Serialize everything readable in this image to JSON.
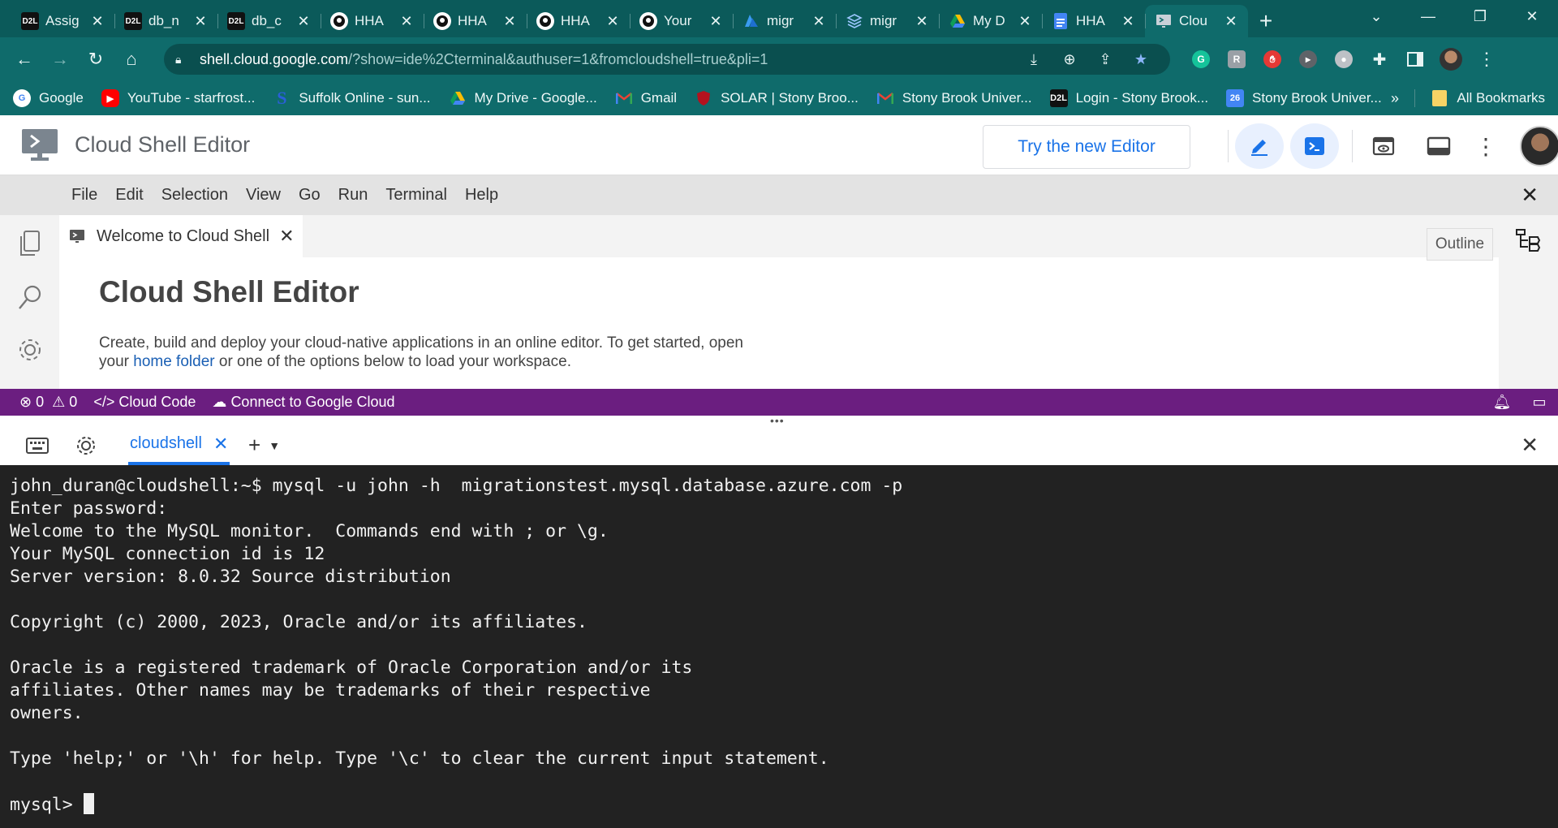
{
  "browser": {
    "tabs": [
      {
        "title": "Assig",
        "icon": "d2l-icon",
        "active": false
      },
      {
        "title": "db_n",
        "icon": "d2l-icon",
        "active": false
      },
      {
        "title": "db_c",
        "icon": "d2l-icon",
        "active": false
      },
      {
        "title": "HHA",
        "icon": "github-icon",
        "active": false
      },
      {
        "title": "HHA",
        "icon": "github-icon",
        "active": false
      },
      {
        "title": "HHA",
        "icon": "github-icon",
        "active": false
      },
      {
        "title": "Your",
        "icon": "github-icon",
        "active": false
      },
      {
        "title": "migr",
        "icon": "azure-icon",
        "active": false
      },
      {
        "title": "migr",
        "icon": "layers-icon",
        "active": false
      },
      {
        "title": "My D",
        "icon": "google-drive-icon",
        "active": false
      },
      {
        "title": "HHA",
        "icon": "google-docs-icon",
        "active": false
      },
      {
        "title": "Clou",
        "icon": "cloud-shell-icon",
        "active": true
      }
    ],
    "url_host": "shell.cloud.google.com",
    "url_rest": "/?show=ide%2Cterminal&authuser=1&fromcloudshell=true&pli=1",
    "bookmarks": [
      {
        "label": "Google",
        "icon": "google-icon"
      },
      {
        "label": "YouTube - starfrost...",
        "icon": "youtube-icon"
      },
      {
        "label": "Suffolk Online - sun...",
        "icon": "suffolk-icon"
      },
      {
        "label": "My Drive - Google...",
        "icon": "google-drive-icon"
      },
      {
        "label": "Gmail",
        "icon": "gmail-icon"
      },
      {
        "label": "SOLAR | Stony Broo...",
        "icon": "shield-icon"
      },
      {
        "label": "Stony Brook Univer...",
        "icon": "gmail-icon"
      },
      {
        "label": "Login - Stony Brook...",
        "icon": "d2l-icon"
      },
      {
        "label": "Stony Brook Univer...",
        "icon": "calendar-icon"
      }
    ],
    "bookmarks_overflow": "»",
    "all_bookmarks": "All Bookmarks"
  },
  "header": {
    "title": "Cloud Shell Editor",
    "try_button": "Try the new Editor"
  },
  "menu": [
    "File",
    "Edit",
    "Selection",
    "View",
    "Go",
    "Run",
    "Terminal",
    "Help"
  ],
  "editor": {
    "tab_label": "Welcome to Cloud Shell",
    "heading": "Cloud Shell Editor",
    "desc_line1": "Create, build and deploy your cloud-native applications in an online editor. To get started, open",
    "desc_prefix": "your ",
    "desc_link": "home folder",
    "desc_suffix": " or one of the options below to load your workspace.",
    "outline_label": "Outline"
  },
  "status": {
    "errors": "0",
    "warnings": "0",
    "cloud_code": "Cloud Code",
    "connect": "Connect to Google Cloud"
  },
  "terminal": {
    "tab_label": "cloudshell",
    "lines": [
      "john_duran@cloudshell:~$ mysql -u john -h  migrationstest.mysql.database.azure.com -p",
      "Enter password:",
      "Welcome to the MySQL monitor.  Commands end with ; or \\g.",
      "Your MySQL connection id is 12",
      "Server version: 8.0.32 Source distribution",
      "",
      "Copyright (c) 2000, 2023, Oracle and/or its affiliates.",
      "",
      "Oracle is a registered trademark of Oracle Corporation and/or its",
      "affiliates. Other names may be trademarks of their respective",
      "owners.",
      "",
      "Type 'help;' or '\\h' for help. Type '\\c' to clear the current input statement.",
      ""
    ],
    "prompt": "mysql> "
  },
  "colors": {
    "browser_frame": "#0f6b6b",
    "status_bar": "#6b1e80",
    "terminal_bg": "#222222",
    "accent_blue": "#1a73e8"
  }
}
